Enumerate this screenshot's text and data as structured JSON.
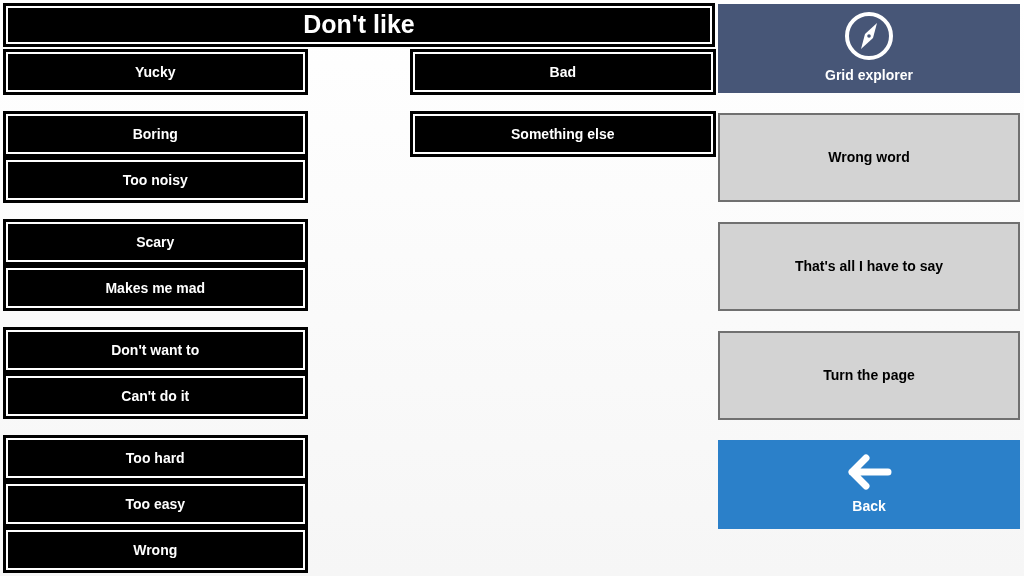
{
  "title": "Don't like",
  "columns": [
    [
      {
        "items": [
          "Yucky"
        ]
      },
      {
        "items": [
          "Boring",
          "Too noisy"
        ]
      },
      {
        "items": [
          "Scary",
          "Makes me mad"
        ]
      },
      {
        "items": [
          "Don't want to",
          "Can't do it"
        ]
      },
      {
        "items": [
          "Too hard",
          "Too easy",
          "Wrong"
        ]
      }
    ],
    [
      {
        "items": [
          "Bad"
        ]
      },
      {
        "items": [
          "Something else"
        ]
      }
    ]
  ],
  "side_buttons": [
    {
      "label": "Grid explorer",
      "kind": "compass"
    },
    {
      "label": "Wrong word",
      "kind": "phrase"
    },
    {
      "label": "That's all I have to say",
      "kind": "phrase"
    },
    {
      "label": "Turn the page",
      "kind": "phrase"
    },
    {
      "label": "Back",
      "kind": "back"
    }
  ]
}
